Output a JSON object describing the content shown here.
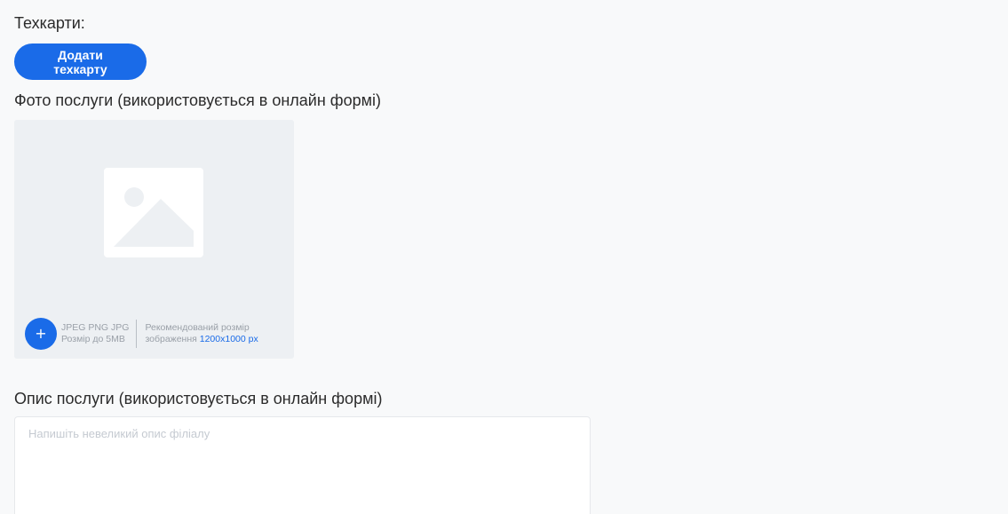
{
  "techcards": {
    "title": "Техкарти:",
    "add_button": "Додати техкарту"
  },
  "photo": {
    "title": "Фото послуги (використовується в онлайн формі)",
    "upload_icon": "+",
    "formats": "JPEG PNG JPG",
    "max_size": "Розмір до 5MB",
    "recommended_label": "Рекомендований розмір",
    "recommended_prefix": "зображення",
    "recommended_size": "1200x1000 px"
  },
  "description": {
    "title": "Опис послуги (використовується в онлайн формі)",
    "placeholder": "Напишіть невеликий опис філіалу",
    "value": ""
  },
  "colors": {
    "accent": "#1a6be8",
    "background": "#f8f9fa",
    "photo_bg": "#edf0f3"
  }
}
